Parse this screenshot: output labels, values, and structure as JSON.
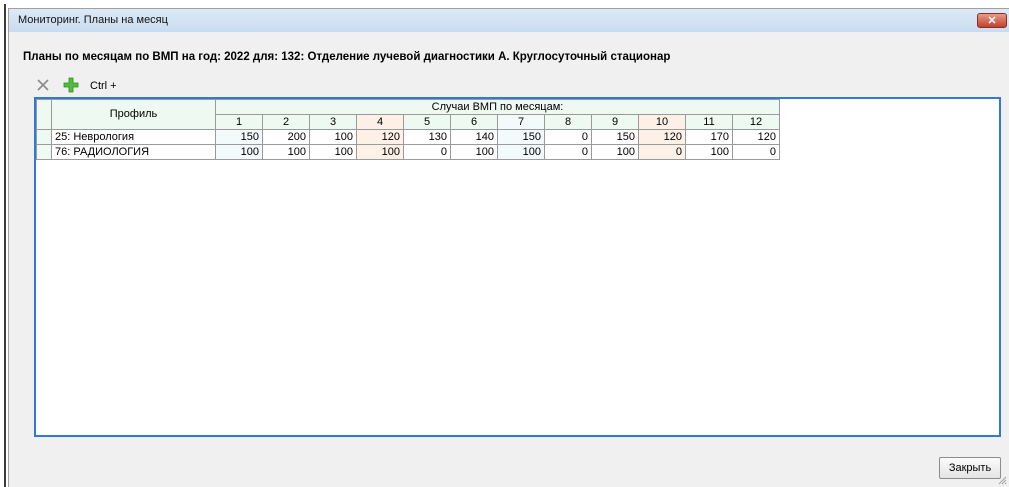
{
  "window": {
    "title": "Мониторинг. Планы на месяц",
    "close_glyph": "✕"
  },
  "heading": "Планы по месяцам по ВМП на год: 2022 для: 132: Отделение лучевой диагностики А. Круглосуточный стационар",
  "toolbar": {
    "delete_icon": "x-icon",
    "add_icon": "plus-icon",
    "add_color": "#4fbf3a",
    "shortcut_label": "Ctrl +"
  },
  "grid": {
    "profile_header": "Профиль",
    "group_header": "Случаи ВМП по месяцам:",
    "months": [
      "1",
      "2",
      "3",
      "4",
      "5",
      "6",
      "7",
      "8",
      "9",
      "10",
      "11",
      "12"
    ],
    "rows": [
      {
        "profile": "25: Неврология",
        "values": [
          "150",
          "200",
          "100",
          "120",
          "130",
          "140",
          "150",
          "0",
          "150",
          "120",
          "170",
          "120"
        ]
      },
      {
        "profile": "76: РАДИОЛОГИЯ",
        "values": [
          "100",
          "100",
          "100",
          "100",
          "0",
          "100",
          "100",
          "0",
          "100",
          "0",
          "100",
          "0"
        ]
      }
    ],
    "accent_border": "#3179d8",
    "header_bg": "#eef9f1",
    "alt_column_bg": "#fdf0e7"
  },
  "footer": {
    "close_label": "Закрыть"
  }
}
